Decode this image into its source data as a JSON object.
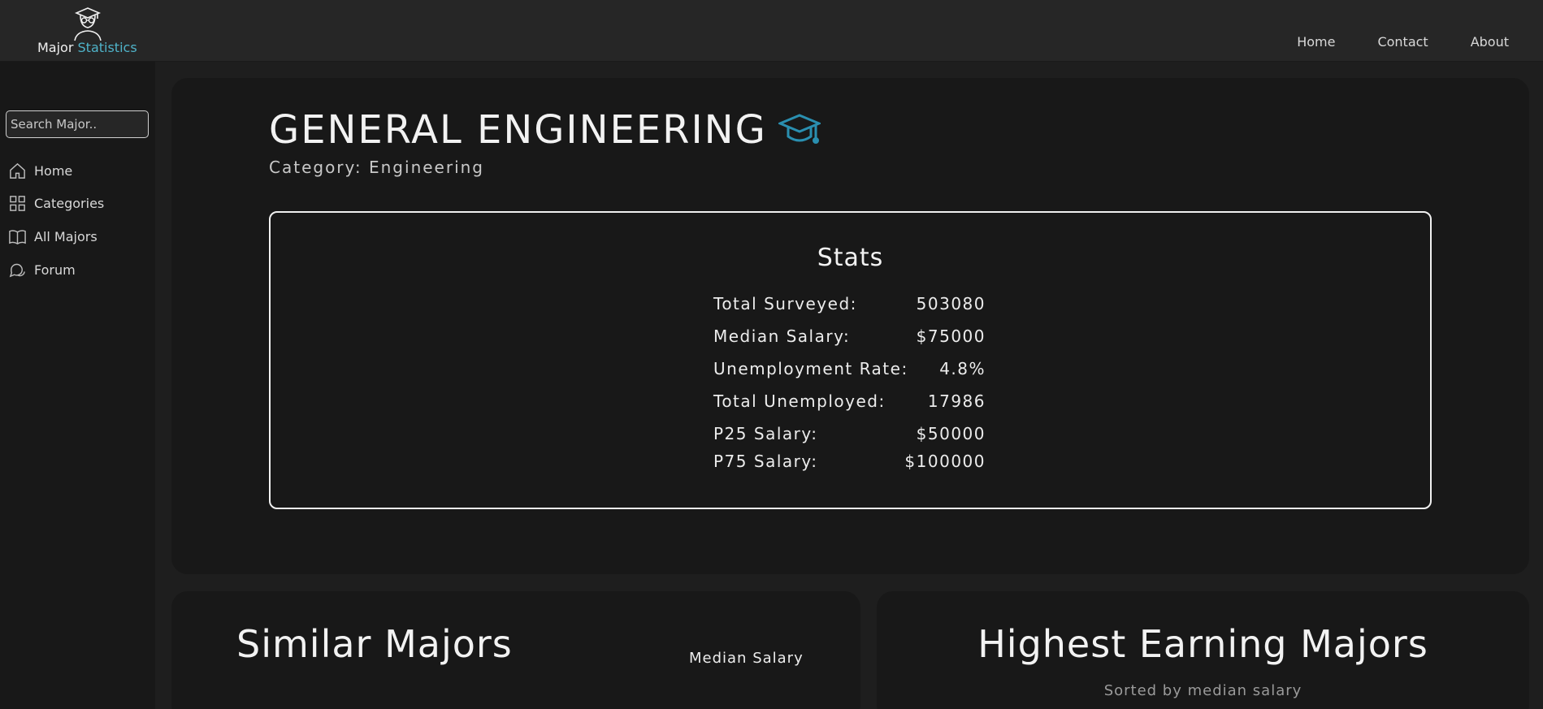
{
  "header": {
    "logo_word1": "Major",
    "logo_word2": "Statistics",
    "nav": [
      "Home",
      "Contact",
      "About"
    ]
  },
  "sidebar": {
    "search_placeholder": "Search Major..",
    "items": [
      {
        "label": "Home",
        "icon": "home-icon"
      },
      {
        "label": "Categories",
        "icon": "grid-icon"
      },
      {
        "label": "All Majors",
        "icon": "book-icon"
      },
      {
        "label": "Forum",
        "icon": "chat-icon"
      }
    ]
  },
  "major": {
    "title": "GENERAL ENGINEERING",
    "category": "Category: Engineering",
    "icon": "graduation-cap-icon"
  },
  "stats": {
    "heading": "Stats",
    "rows": [
      {
        "label": "Total Surveyed:",
        "value": "503080"
      },
      {
        "label": "Median Salary:",
        "value": "$75000"
      },
      {
        "label": "Unemployment Rate:",
        "value": "4.8%"
      },
      {
        "label": "Total Unemployed:",
        "value": "17986"
      },
      {
        "label": "P25 Salary:",
        "value": "$50000"
      },
      {
        "label": "P75 Salary:",
        "value": "$100000"
      }
    ]
  },
  "similar": {
    "title": "Similar Majors",
    "column": "Median Salary"
  },
  "highest": {
    "title": "Highest Earning Majors",
    "subtitle": "Sorted by median salary"
  },
  "colors": {
    "accent": "#4fb3c9",
    "cap": "#2a8fb0",
    "background": "#1e1e1e",
    "card": "#181818"
  }
}
